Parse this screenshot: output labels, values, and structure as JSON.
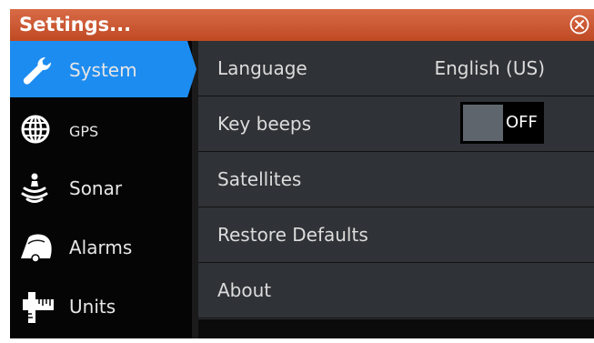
{
  "window": {
    "title": "Settings...",
    "close_icon": "close-circle-icon"
  },
  "sidebar": {
    "items": [
      {
        "label": "System",
        "icon": "wrench-icon",
        "active": true
      },
      {
        "label": "GPS",
        "icon": "globe-icon",
        "active": false
      },
      {
        "label": "Sonar",
        "icon": "sonar-icon",
        "active": false
      },
      {
        "label": "Alarms",
        "icon": "alarm-bell-icon",
        "active": false
      },
      {
        "label": "Units",
        "icon": "ruler-icon",
        "active": false
      }
    ]
  },
  "settings": {
    "rows": [
      {
        "label": "Language",
        "value": "English (US)"
      },
      {
        "label": "Key beeps",
        "toggle": "OFF"
      },
      {
        "label": "Satellites"
      },
      {
        "label": "Restore Defaults"
      },
      {
        "label": "About"
      }
    ]
  },
  "colors": {
    "titlebar": "#c9542f",
    "active_item": "#1d8cf0",
    "panel": "#2f3236",
    "sidebar": "#050505"
  }
}
